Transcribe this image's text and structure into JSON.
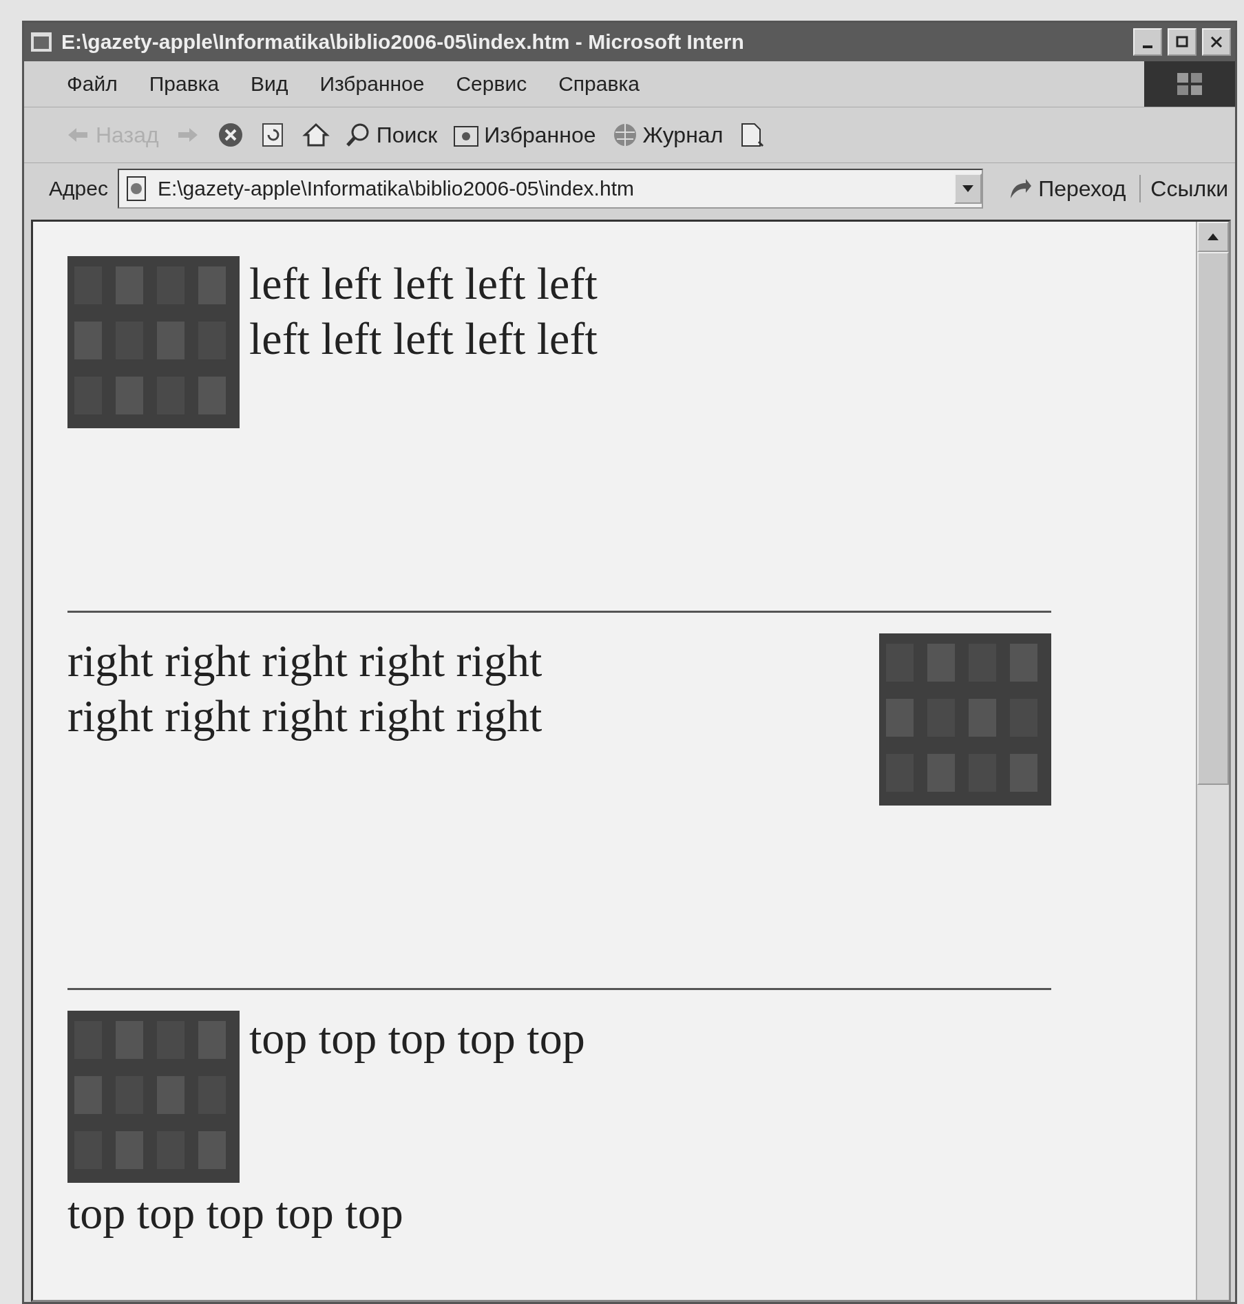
{
  "window": {
    "title": "E:\\gazety-apple\\Informatika\\biblio2006-05\\index.htm - Microsoft Intern"
  },
  "menu": [
    "Файл",
    "Правка",
    "Вид",
    "Избранное",
    "Сервис",
    "Справка"
  ],
  "toolbar": [
    {
      "kind": "back",
      "label": "Назад",
      "disabled": true
    },
    {
      "kind": "forward",
      "disabled": true
    },
    {
      "kind": "stop",
      "disabled": false
    },
    {
      "kind": "refresh",
      "disabled": false
    },
    {
      "kind": "home",
      "disabled": false
    },
    {
      "kind": "search",
      "label": "Поиск",
      "disabled": false
    },
    {
      "kind": "favorites",
      "label": "Избранное",
      "disabled": false
    },
    {
      "kind": "history",
      "label": "Журнал",
      "disabled": false
    },
    {
      "kind": "edit",
      "disabled": false
    }
  ],
  "address_bar": {
    "label": "Адрес",
    "value": "E:\\gazety-apple\\Informatika\\biblio2006-05\\index.htm",
    "go": "Переход",
    "links": "Ссылки"
  },
  "sections": [
    {
      "kind": "left",
      "lines": [
        "left left left left left",
        "left left left left left"
      ]
    },
    {
      "kind": "right",
      "lines": [
        "right right right right right",
        "right right right right right"
      ]
    },
    {
      "kind": "top",
      "lines": [
        "top top top top top",
        "top top top top top"
      ]
    }
  ]
}
